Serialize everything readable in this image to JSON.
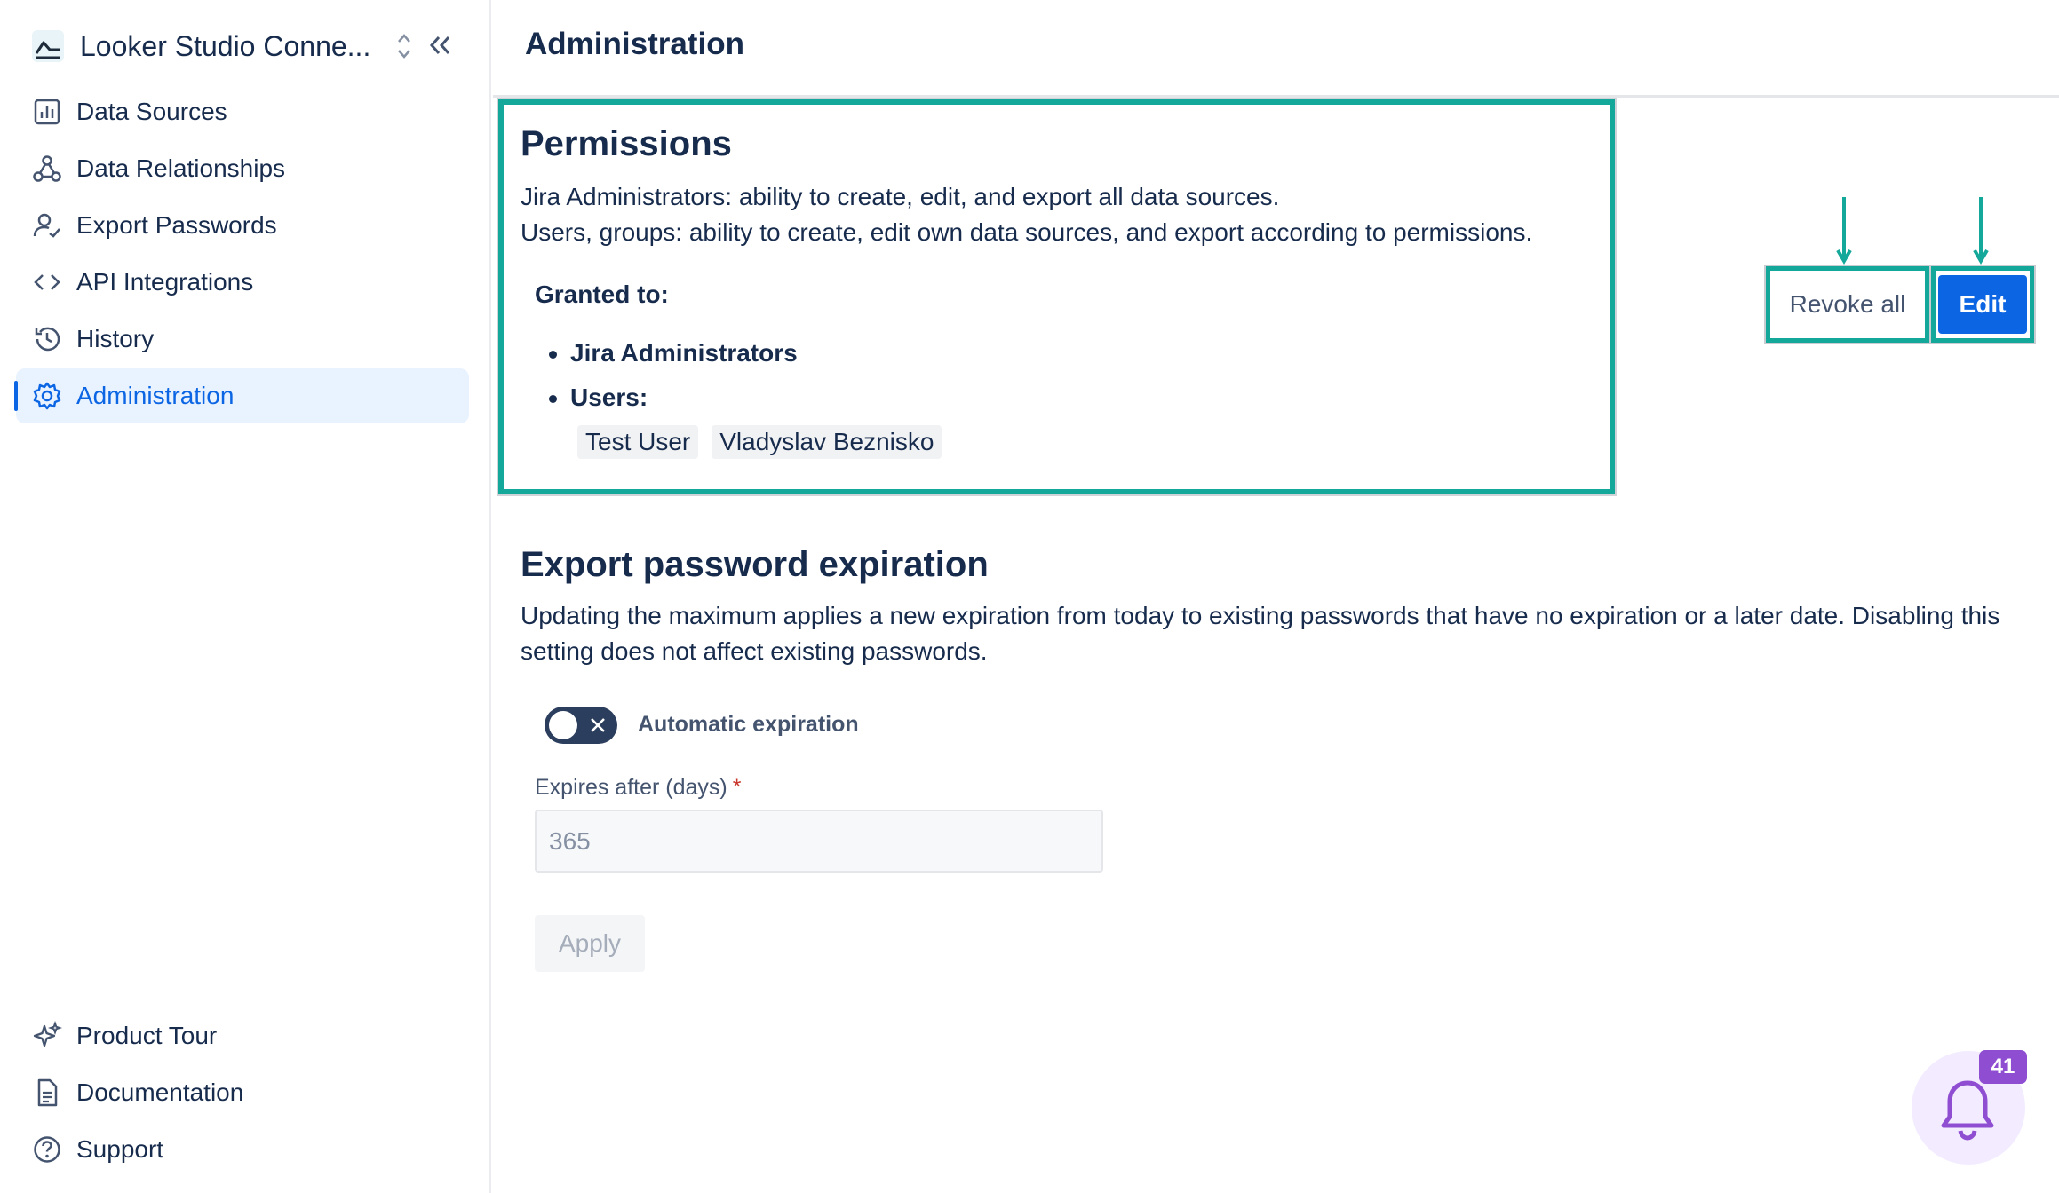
{
  "app": {
    "title": "Looker Studio Conne..."
  },
  "sidebar": {
    "items": [
      {
        "label": "Data Sources",
        "icon": "bar-chart-icon"
      },
      {
        "label": "Data Relationships",
        "icon": "relationships-icon"
      },
      {
        "label": "Export Passwords",
        "icon": "user-check-icon"
      },
      {
        "label": "API Integrations",
        "icon": "code-icon"
      },
      {
        "label": "History",
        "icon": "history-icon"
      },
      {
        "label": "Administration",
        "icon": "gear-icon",
        "active": true
      }
    ],
    "bottom_items": [
      {
        "label": "Product Tour",
        "icon": "sparkle-icon"
      },
      {
        "label": "Documentation",
        "icon": "document-icon"
      },
      {
        "label": "Support",
        "icon": "help-icon"
      }
    ]
  },
  "header": {
    "title": "Administration"
  },
  "permissions": {
    "title": "Permissions",
    "description_line1": "Jira Administrators: ability to create, edit, and export all data sources.",
    "description_line2": "Users, groups: ability to create, edit own data sources, and export according to permissions.",
    "granted_label": "Granted to:",
    "grants": [
      "Jira Administrators",
      "Users:"
    ],
    "users": [
      "Test User",
      "Vladyslav Beznisko"
    ],
    "revoke_label": "Revoke all",
    "edit_label": "Edit"
  },
  "export_expiration": {
    "title": "Export password expiration",
    "description": "Updating the maximum applies a new expiration from today to existing passwords that have no expiration or a later date. Disabling this setting does not affect existing passwords.",
    "toggle_label": "Automatic expiration",
    "toggle_on": false,
    "field_label": "Expires after (days)",
    "field_value": "365",
    "apply_label": "Apply"
  },
  "notifications": {
    "count": "41"
  },
  "colors": {
    "accent": "#0c66e4",
    "highlight": "#14a89a",
    "notification": "#8f4ed1"
  }
}
